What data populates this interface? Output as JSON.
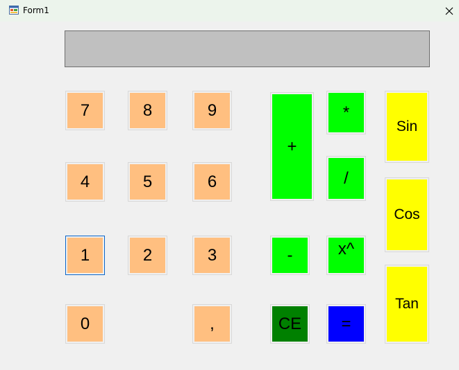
{
  "window": {
    "title": "Form1",
    "icon": "form-icon",
    "close_icon": "close-icon"
  },
  "display": {
    "value": ""
  },
  "buttons": {
    "seven": "7",
    "eight": "8",
    "nine": "9",
    "four": "4",
    "five": "5",
    "six": "6",
    "one": "1",
    "two": "2",
    "three": "3",
    "zero": "0",
    "comma": ",",
    "plus": "+",
    "minus": "-",
    "multiply": "*",
    "divide": "/",
    "power": "x^",
    "clear": "CE",
    "equals": "=",
    "sin": "Sin",
    "cos": "Cos",
    "tan": "Tan"
  },
  "colors": {
    "digit": "#ffbf80",
    "operator": "#00ff00",
    "clear": "#008000",
    "equals": "#0000ff",
    "trig": "#ffff00",
    "display": "#c0c0c0"
  }
}
